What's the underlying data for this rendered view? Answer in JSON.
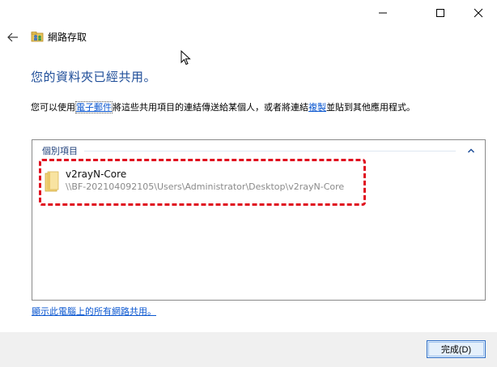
{
  "window": {
    "title": "網路存取",
    "controls": {
      "minimize": "minimize-icon",
      "maximize": "maximize-icon",
      "close": "close-icon"
    }
  },
  "heading": "您的資料夾已經共用。",
  "description": {
    "before": "您可以使用",
    "email_link": "電子郵件",
    "middle": "將這些共用項目的連結傳送給某個人，或者將連結",
    "copy_link": "複製",
    "after": "並貼到其他應用程式。"
  },
  "items_group": {
    "title": "個別項目",
    "items": [
      {
        "name": "v2rayN-Core",
        "path": "\\\\BF-202104092105\\Users\\Administrator\\Desktop\\v2rayN-Core"
      }
    ]
  },
  "show_all_link": "顯示此電腦上的所有網路共用。",
  "footer": {
    "done_label": "完成(D)"
  },
  "colors": {
    "heading": "#1f4e99",
    "link": "#0b57d0",
    "highlight_border": "#e0101f"
  }
}
